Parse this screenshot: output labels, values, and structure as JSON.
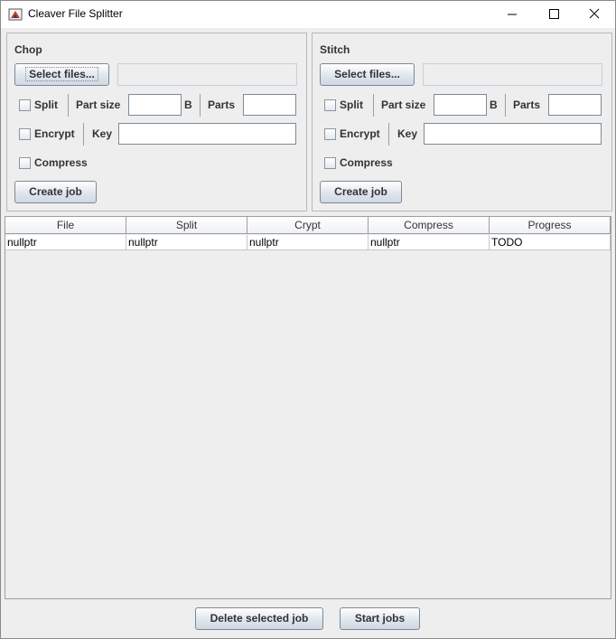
{
  "window": {
    "title": "Cleaver File Splitter"
  },
  "chop": {
    "title": "Chop",
    "select_files_label": "Select files...",
    "split_label": "Split",
    "part_size_label": "Part size",
    "unit_label": "B",
    "parts_label": "Parts",
    "encrypt_label": "Encrypt",
    "key_label": "Key",
    "compress_label": "Compress",
    "create_job_label": "Create job"
  },
  "stitch": {
    "title": "Stitch",
    "select_files_label": "Select files...",
    "split_label": "Split",
    "part_size_label": "Part size",
    "unit_label": "B",
    "parts_label": "Parts",
    "encrypt_label": "Encrypt",
    "key_label": "Key",
    "compress_label": "Compress",
    "create_job_label": "Create job"
  },
  "table": {
    "columns": [
      "File",
      "Split",
      "Crypt",
      "Compress",
      "Progress"
    ],
    "rows": [
      [
        "nullptr",
        "nullptr",
        "nullptr",
        "nullptr",
        "TODO"
      ]
    ]
  },
  "footer": {
    "delete_label": "Delete selected job",
    "start_label": "Start jobs"
  }
}
